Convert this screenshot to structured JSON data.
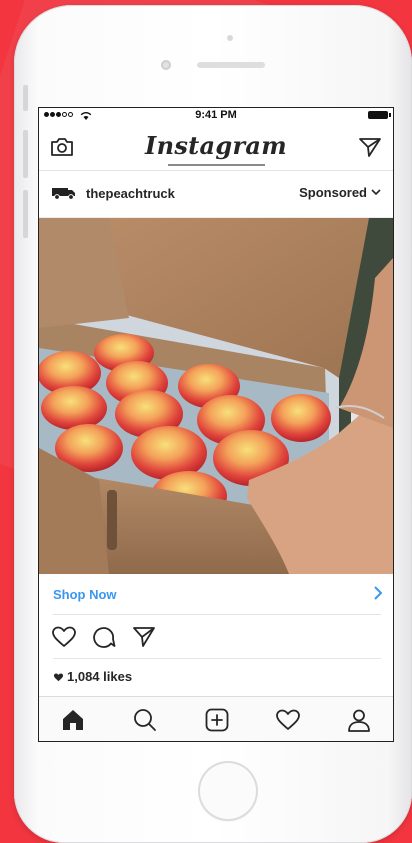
{
  "status_bar": {
    "time": "9:41 PM"
  },
  "header": {
    "logo": "Instagram"
  },
  "post": {
    "username": "thepeachtruck",
    "sponsored_label": "Sponsored",
    "cta_label": "Shop Now",
    "likes": "1,084 likes"
  },
  "icons": {
    "header_left": "camera-icon",
    "header_right": "direct-message-icon",
    "avatar": "truck-icon",
    "actions": [
      "heart-icon",
      "comment-icon",
      "share-icon"
    ],
    "tabs": [
      "home-icon",
      "search-icon",
      "add-post-icon",
      "activity-icon",
      "profile-icon"
    ]
  },
  "colors": {
    "background": "#f2353f",
    "link": "#3897f0",
    "text": "#262626"
  }
}
